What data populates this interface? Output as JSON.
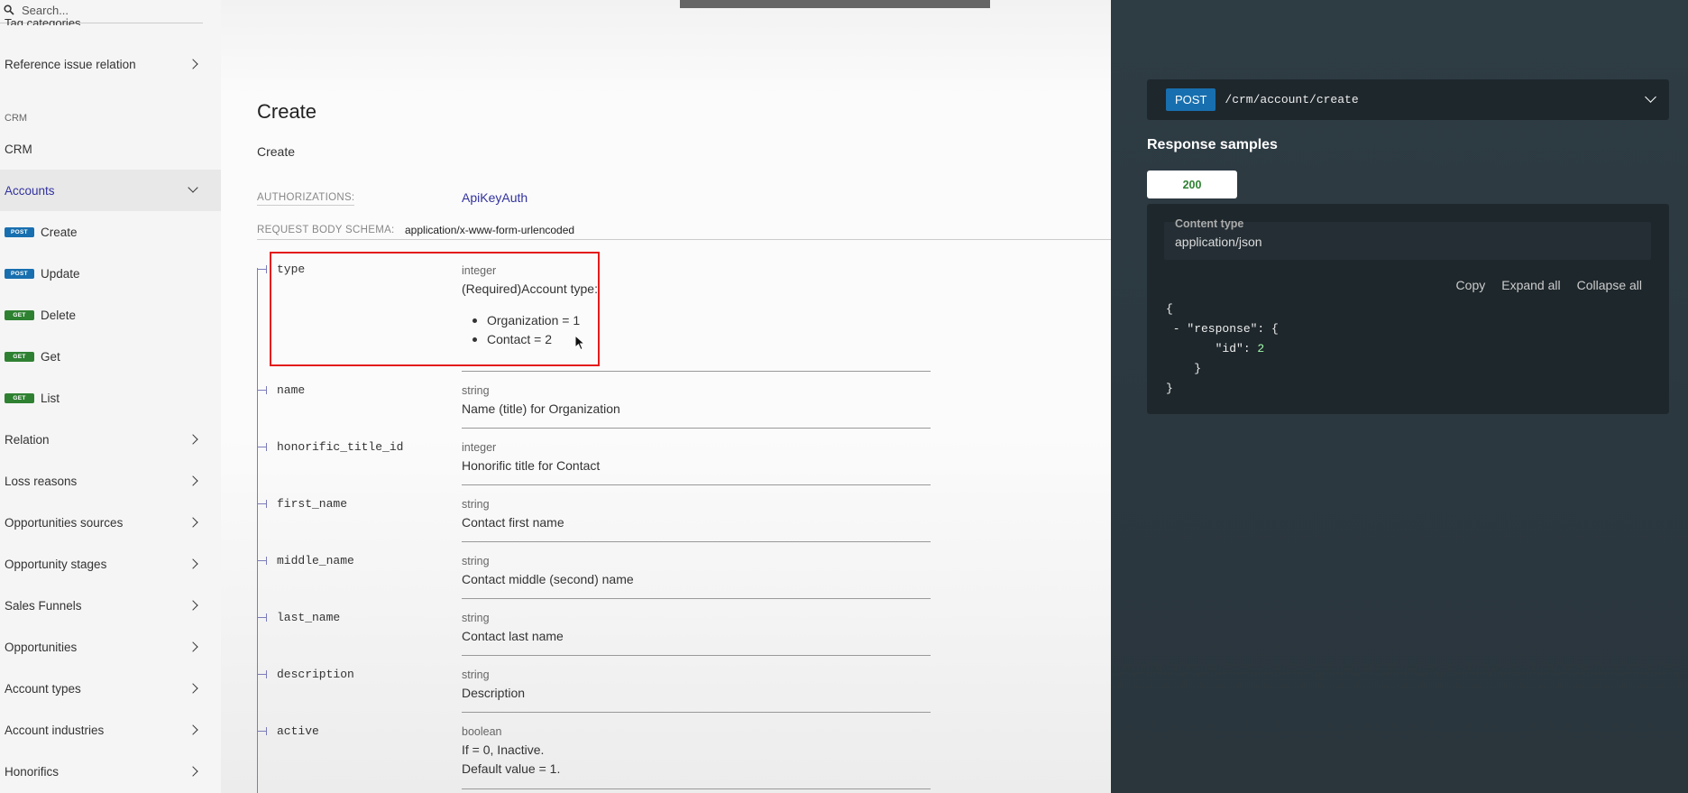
{
  "sidebar": {
    "search_placeholder": "Search...",
    "cut_item": "Tag categories",
    "item_reference_issue": "Reference issue relation",
    "section_crm": "CRM",
    "item_crm": "CRM",
    "item_accounts": "Accounts",
    "sub_items": [
      {
        "method": "POST",
        "label": "Create"
      },
      {
        "method": "POST",
        "label": "Update"
      },
      {
        "method": "GET",
        "label": "Delete"
      },
      {
        "method": "GET",
        "label": "Get"
      },
      {
        "method": "GET",
        "label": "List"
      }
    ],
    "groups": [
      "Relation",
      "Loss reasons",
      "Opportunities sources",
      "Opportunity stages",
      "Sales Funnels",
      "Opportunities",
      "Account types",
      "Account industries",
      "Honorifics"
    ]
  },
  "main": {
    "title": "Create",
    "subtitle": "Create",
    "auth_label": "AUTHORIZATIONS:",
    "auth_value": "ApiKeyAuth",
    "schema_label": "REQUEST BODY SCHEMA:",
    "schema_value": "application/x-www-form-urlencoded",
    "fields": [
      {
        "name": "type",
        "type": "integer",
        "desc": "(Required)Account type:",
        "bullets": [
          "Organization = 1",
          "Contact = 2"
        ]
      },
      {
        "name": "name",
        "type": "string",
        "desc": "Name (title) for Organization"
      },
      {
        "name": "honorific_title_id",
        "type": "integer",
        "desc": "Honorific title for Contact"
      },
      {
        "name": "first_name",
        "type": "string",
        "desc": "Contact first name"
      },
      {
        "name": "middle_name",
        "type": "string",
        "desc": "Contact middle (second) name"
      },
      {
        "name": "last_name",
        "type": "string",
        "desc": "Contact last name"
      },
      {
        "name": "description",
        "type": "string",
        "desc": "Description"
      },
      {
        "name": "active",
        "type": "boolean",
        "desc": "If = 0, Inactive.",
        "desc2": "Default value = 1."
      }
    ]
  },
  "right": {
    "method": "POST",
    "path": "/crm/account/create",
    "response_title": "Response samples",
    "tab_200": "200",
    "ctype_label": "Content type",
    "ctype_value": "application/json",
    "copy": "Copy",
    "expand_all": "Expand all",
    "collapse_all": "Collapse all",
    "json_open": "{",
    "json_line2_prefix": " - \"response\": {",
    "json_line3_key": "\"id\": ",
    "json_line3_val": "2",
    "json_line4": "}",
    "json_close": "}"
  },
  "colors": {
    "post": "#186faf",
    "get": "#2f8132",
    "accent": "#32329f",
    "highlight": "#e41b1b"
  }
}
